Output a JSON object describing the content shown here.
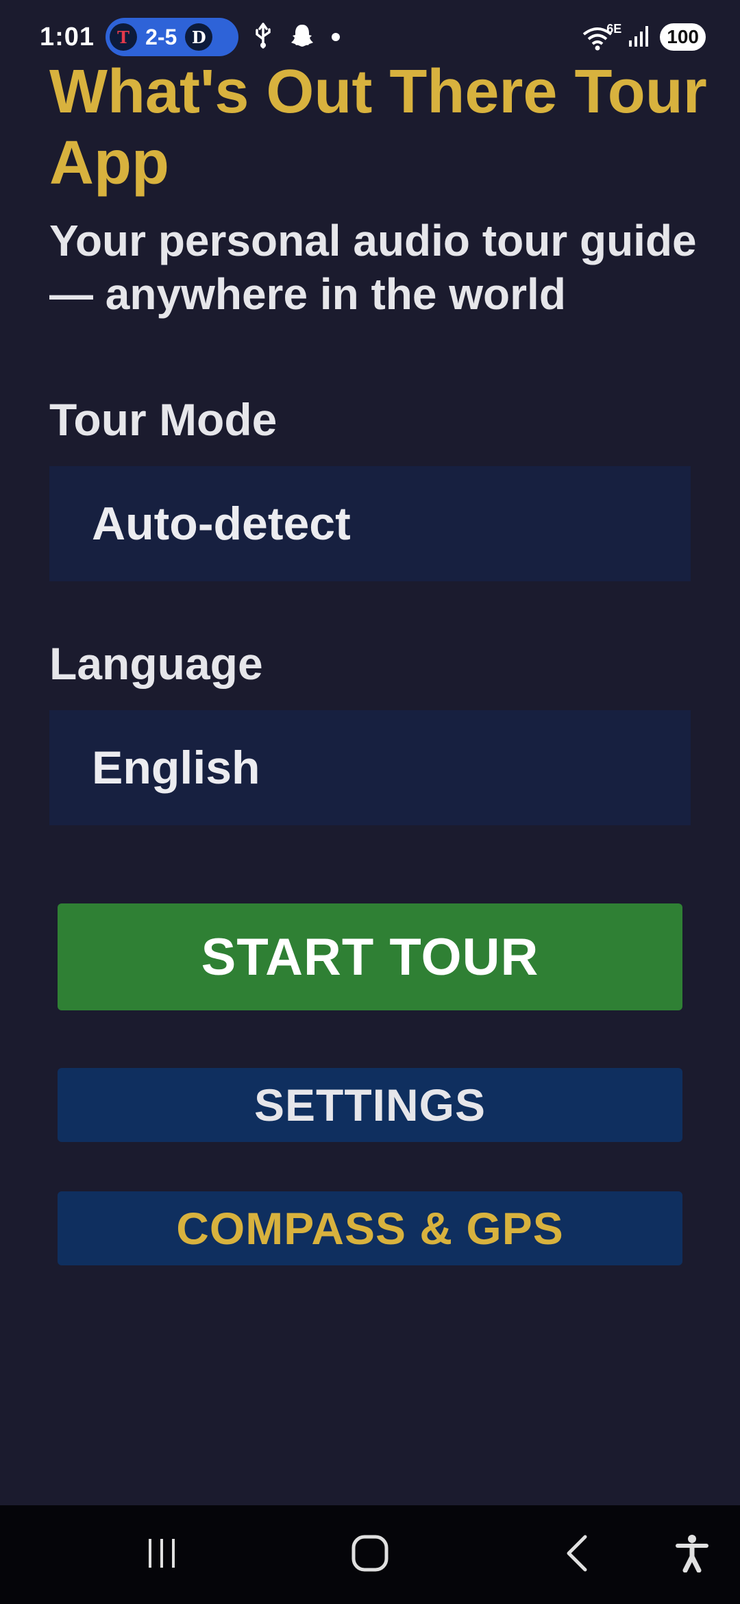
{
  "status_bar": {
    "time": "1:01",
    "score": "2-5",
    "team_left_logo": "T",
    "team_right_logo": "D",
    "network": "6E",
    "battery": "100"
  },
  "app": {
    "title": "What's Out There Tour App",
    "subtitle": "Your personal audio tour guide — anywhere in the world"
  },
  "tour_mode": {
    "label": "Tour Mode",
    "value": "Auto-detect"
  },
  "language": {
    "label": "Language",
    "value": "English"
  },
  "buttons": {
    "start": "START TOUR",
    "settings": "SETTINGS",
    "compass": "COMPASS & GPS"
  },
  "colors": {
    "background": "#1b1b2e",
    "accent_gold": "#d8b23e",
    "start_green": "#2f8034",
    "button_navy": "#0f2f5f",
    "field_bg": "#172040"
  },
  "icons": {
    "usb": "usb-icon",
    "snapchat": "snapchat-ghost-icon",
    "wifi": "wifi-icon",
    "signal": "signal-icon",
    "recents": "recents-icon",
    "home": "home-icon",
    "back": "back-icon",
    "accessibility": "accessibility-icon"
  }
}
